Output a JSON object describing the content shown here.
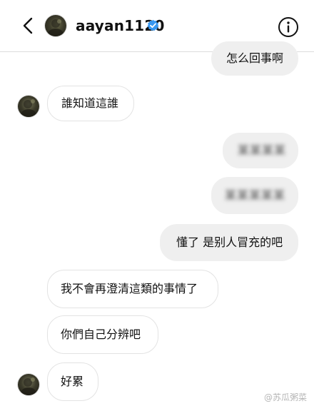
{
  "header": {
    "username": "aayan1120",
    "verified": true,
    "back_icon": "chevron-left-icon",
    "info_icon": "info-icon"
  },
  "messages": [
    {
      "id": "m1",
      "sender": "me",
      "text": "怎么回事啊"
    },
    {
      "id": "m2",
      "sender": "them",
      "text": "誰知道這誰",
      "show_avatar": true
    },
    {
      "id": "m3",
      "sender": "me",
      "text": "某某某某",
      "blurred": true
    },
    {
      "id": "m4",
      "sender": "me",
      "text": "某某某某某",
      "blurred": true
    },
    {
      "id": "m5",
      "sender": "me",
      "text": "懂了 是别人冒充的吧"
    },
    {
      "id": "m6",
      "sender": "them",
      "text": "我不會再澄清這類的事情了"
    },
    {
      "id": "m7",
      "sender": "them",
      "text": "你們自己分辨吧"
    },
    {
      "id": "m8",
      "sender": "them",
      "text": "好累",
      "show_avatar": true
    }
  ],
  "watermark": "@苏瓜粥菜",
  "colors": {
    "verified_blue": "#3897f0",
    "outgoing_bubble": "#efefef",
    "incoming_border": "#e3e3e3"
  }
}
